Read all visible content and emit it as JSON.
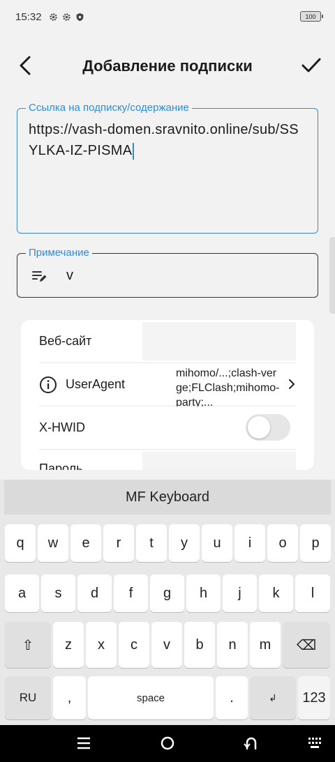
{
  "status": {
    "time": "15:32",
    "battery": "100"
  },
  "header": {
    "title": "Добавление подписки"
  },
  "url_field": {
    "label": "Ссылка на подписку/содержание",
    "value": "https://vash-domen.sravnito.online/sub/SSYLKA-IZ-PISMA"
  },
  "note_field": {
    "label": "Примечание",
    "value": "v"
  },
  "settings": {
    "website_label": "Веб-сайт",
    "useragent_label": "UserAgent",
    "useragent_value": "mihomo/...;clash-verge;FLClash;mihomo-party;...",
    "xhwid_label": "X-HWID",
    "xhwid_enabled": false,
    "password_label": "Пароль"
  },
  "keyboard": {
    "banner": "MF Keyboard",
    "row1": [
      "q",
      "w",
      "e",
      "r",
      "t",
      "y",
      "u",
      "i",
      "o",
      "p"
    ],
    "row2": [
      "a",
      "s",
      "d",
      "f",
      "g",
      "h",
      "j",
      "k",
      "l"
    ],
    "row3": [
      "z",
      "x",
      "c",
      "v",
      "b",
      "n",
      "m"
    ],
    "shift": "⇧",
    "backspace": "⌫",
    "lang": "RU",
    "comma": ",",
    "space": "space",
    "period": ".",
    "enter": "↲",
    "numbers": "123"
  }
}
